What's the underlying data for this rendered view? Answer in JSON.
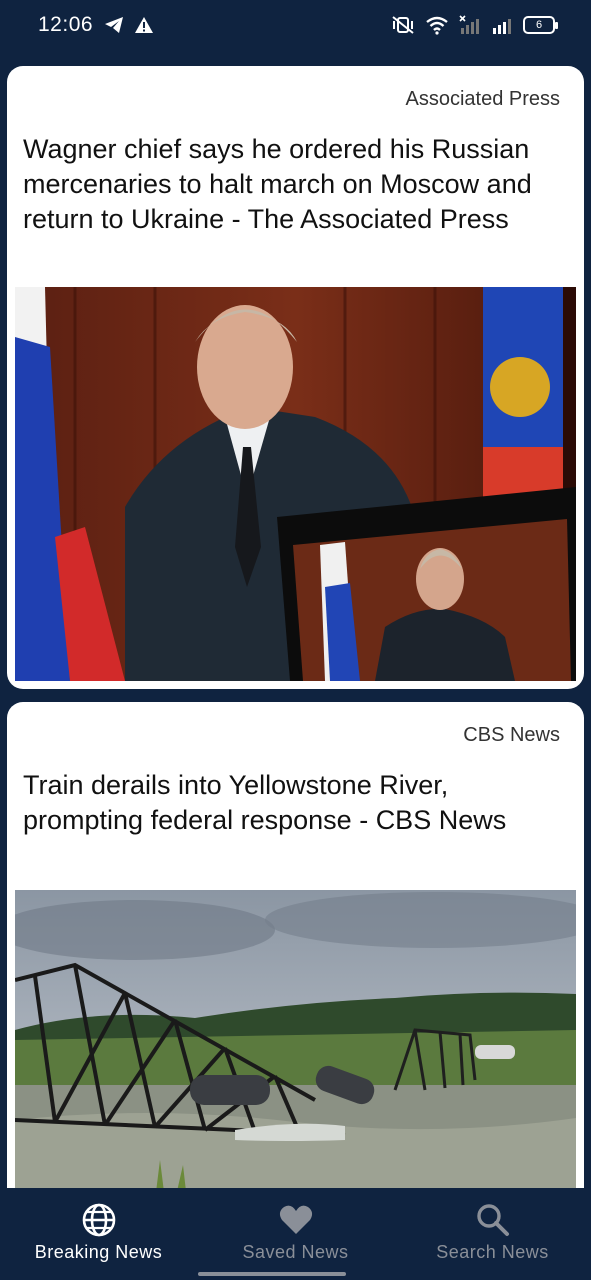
{
  "status_bar": {
    "time": "12:06",
    "battery": "6",
    "icons": [
      "telegram-icon",
      "warning-icon",
      "mute-vibrate-icon",
      "wifi-icon",
      "signal-x-icon",
      "signal-icon",
      "battery-icon"
    ]
  },
  "articles": [
    {
      "source": "Associated Press",
      "title": "Wagner chief says he ordered his Russian mercenaries to halt march on Moscow and return to Ukraine - The Associated Press",
      "image": "putin-address-photo"
    },
    {
      "source": "CBS News",
      "title": "Train derails into Yellowstone River, prompting federal response - CBS News",
      "image": "train-bridge-collapse-photo"
    }
  ],
  "bottom_nav": {
    "items": [
      {
        "label": "Breaking News",
        "icon": "globe-icon",
        "active": true
      },
      {
        "label": "Saved News",
        "icon": "heart-icon",
        "active": false
      },
      {
        "label": "Search News",
        "icon": "search-icon",
        "active": false
      }
    ]
  },
  "colors": {
    "background": "#0f2340",
    "card": "#ffffff",
    "nav_active": "#ffffff",
    "nav_inactive": "#8a8f98"
  }
}
